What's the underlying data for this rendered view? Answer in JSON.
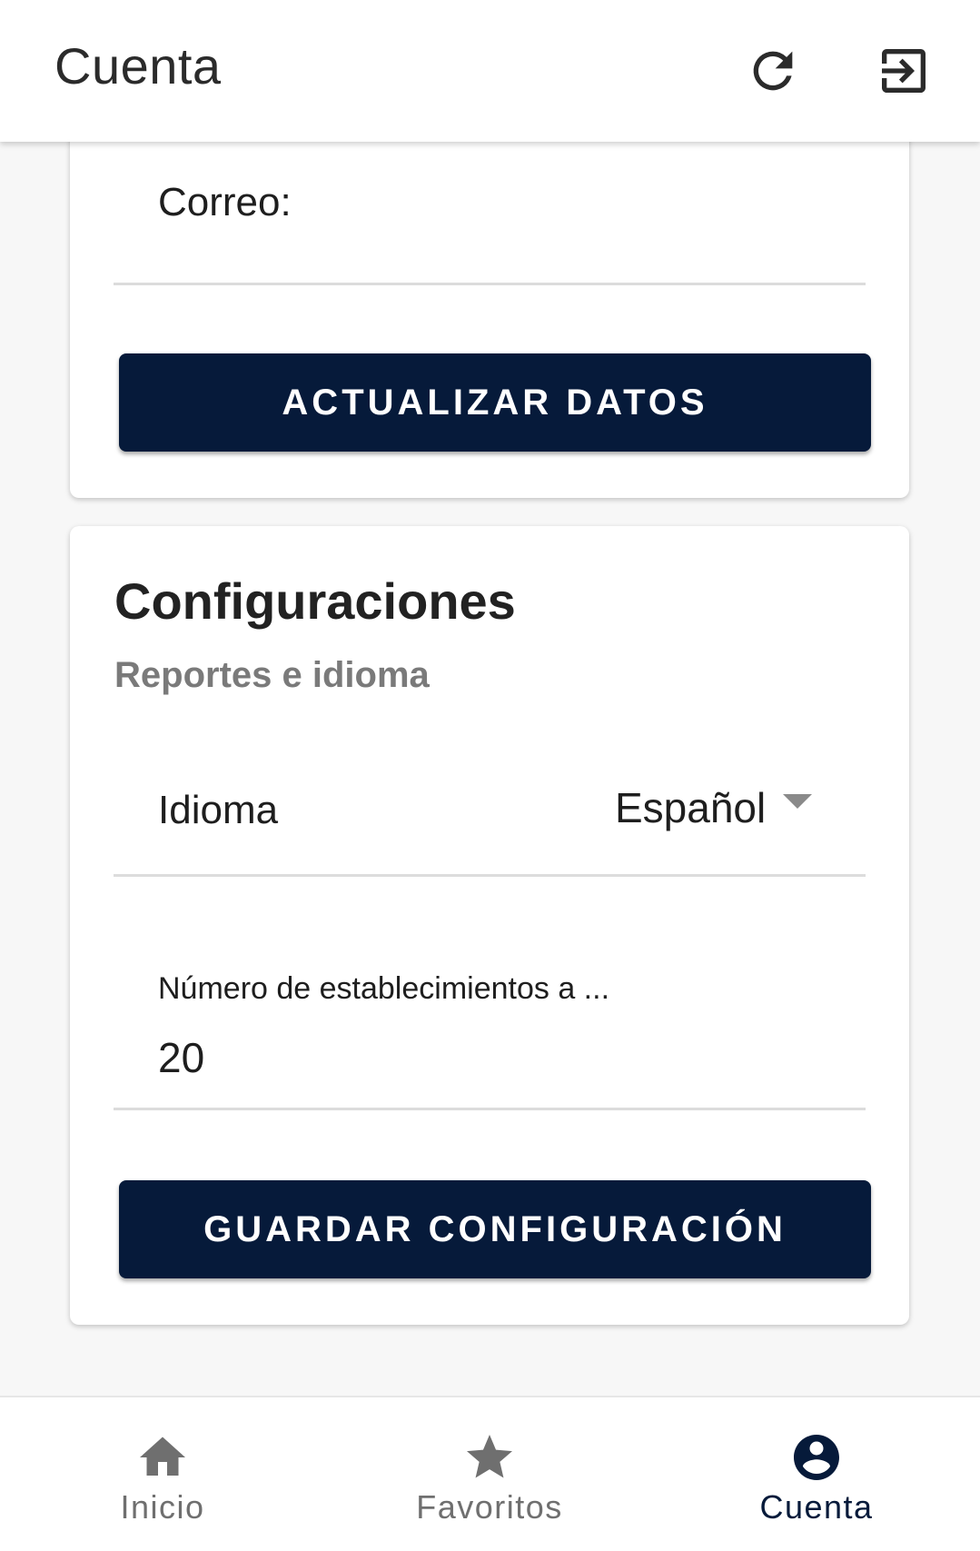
{
  "app_bar": {
    "title": "Cuenta",
    "actions": {
      "refresh_icon": "refresh-icon",
      "logout_icon": "logout-icon"
    }
  },
  "profile_card": {
    "email_label": "Correo:",
    "update_button": "ACTUALIZAR DATOS"
  },
  "config_card": {
    "title": "Configuraciones",
    "subtitle": "Reportes e idioma",
    "language": {
      "label": "Idioma",
      "value": "Español"
    },
    "establishments": {
      "label": "Número de establecimientos a ...",
      "value": "20"
    },
    "save_button": "GUARDAR CONFIGURACIÓN"
  },
  "bottom_nav": {
    "active": "Cuenta",
    "items": [
      {
        "label": "Inicio",
        "icon": "home-icon"
      },
      {
        "label": "Favoritos",
        "icon": "star-icon"
      },
      {
        "label": "Cuenta",
        "icon": "account-circle-icon"
      }
    ]
  },
  "colors": {
    "primary": "#061a3a",
    "inactive": "#6f6f6f",
    "background": "#f7f7f7",
    "subtitle": "#7a7a7a"
  }
}
